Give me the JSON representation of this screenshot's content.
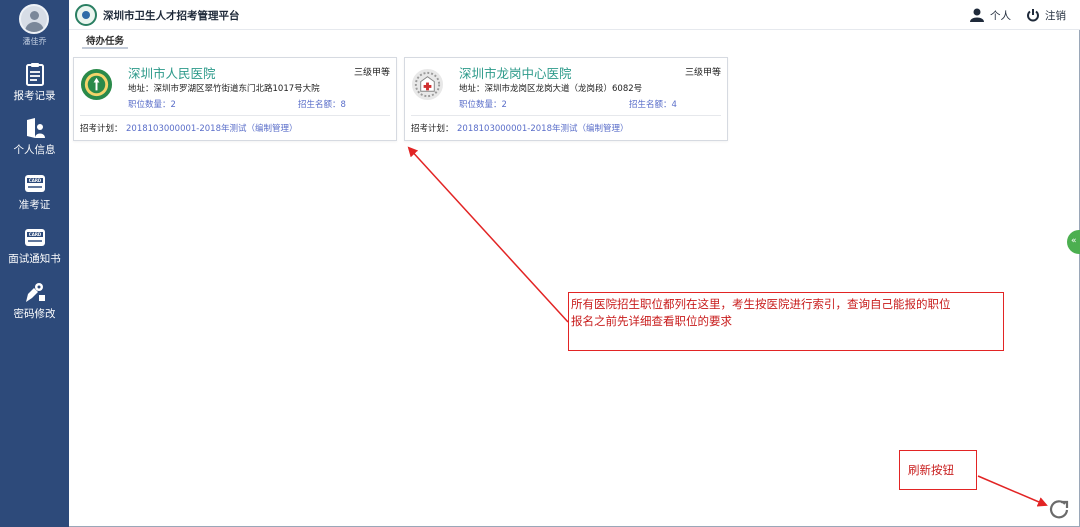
{
  "sidebar": {
    "user_name": "潘佳乔",
    "items": [
      {
        "label": "报考记录",
        "icon": "clipboard-icon"
      },
      {
        "label": "个人信息",
        "icon": "id-user-icon"
      },
      {
        "label": "准考证",
        "icon": "card-icon",
        "badge": "CARD"
      },
      {
        "label": "面试通知书",
        "icon": "card-icon",
        "badge": "CARD"
      },
      {
        "label": "密码修改",
        "icon": "key-icon"
      }
    ]
  },
  "header": {
    "title": "深圳市卫生人才招考管理平台",
    "personal_label": "个人",
    "logout_label": "注销"
  },
  "tabs": [
    {
      "label": "待办任务"
    }
  ],
  "hospitals": [
    {
      "name": "深圳市人民医院",
      "grade": "三级甲等",
      "address": "地址：深圳市罗湖区翠竹街道东门北路1017号大院",
      "positions": "职位数量：2",
      "quota": "招生名额：8",
      "plan_label": "招考计划：",
      "plan_value": "2018103000001-2018年测试（编制管理）"
    },
    {
      "name": "深圳市龙岗中心医院",
      "grade": "三级甲等",
      "address": "地址：深圳市龙岗区龙岗大道（龙岗段）6082号",
      "positions": "职位数量：2",
      "quota": "招生名额：4",
      "plan_label": "招考计划：",
      "plan_value": "2018103000001-2018年测试（编制管理）"
    }
  ],
  "annotations": {
    "main_line1": "所有医院招生职位都列在这里，考生按医院进行索引，查询自己能报的职位",
    "main_line2": "报名之前先详细查看职位的要求",
    "refresh_note": "刷新按钮"
  },
  "colors": {
    "sidebar": "#2d4a7a",
    "hospital_name": "#2d9a8a",
    "link_blue": "#5a6ec9",
    "annotation_red": "#e22424"
  }
}
